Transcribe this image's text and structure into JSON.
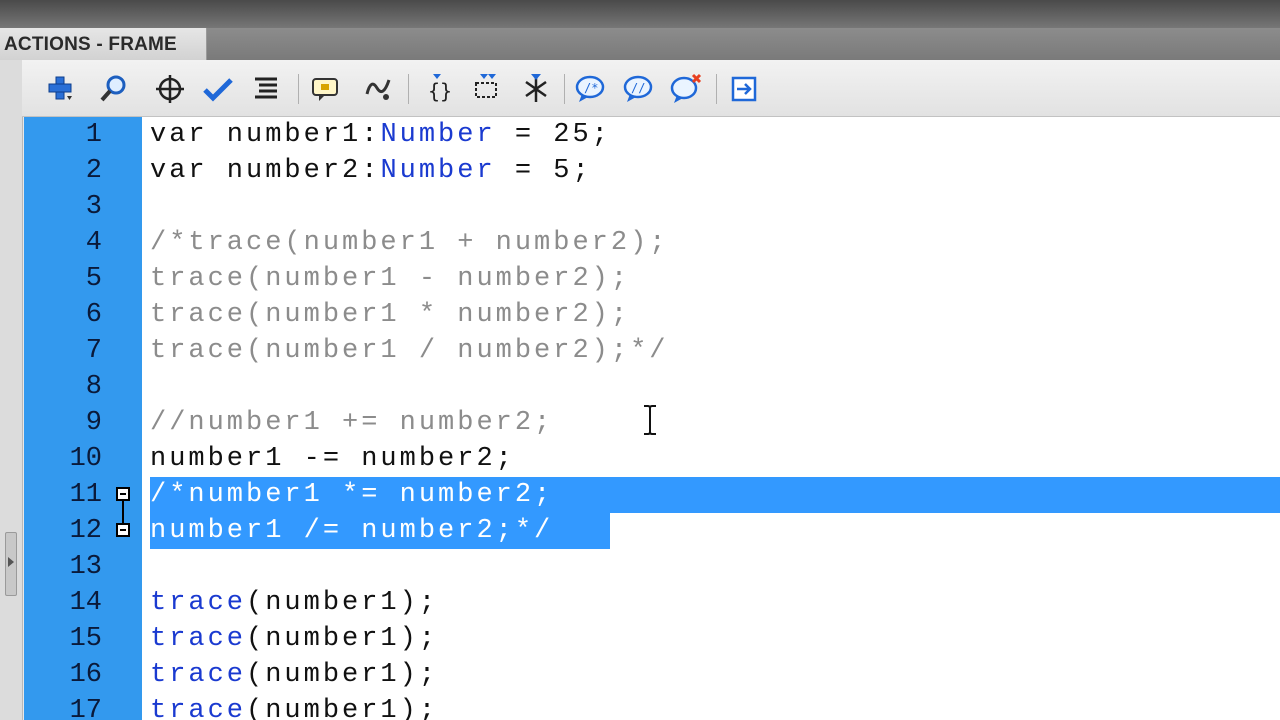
{
  "panel": {
    "title": "ACTIONS - FRAME"
  },
  "toolbar": {
    "buttons": [
      {
        "name": "add-statement-icon",
        "tooltip": ""
      },
      {
        "name": "find-icon",
        "tooltip": ""
      },
      {
        "name": "insert-target-path-icon",
        "tooltip": ""
      },
      {
        "name": "check-syntax-icon",
        "tooltip": ""
      },
      {
        "name": "auto-format-icon",
        "tooltip": ""
      },
      {
        "name": "show-code-hint-icon",
        "tooltip": ""
      },
      {
        "name": "debug-options-icon",
        "tooltip": ""
      },
      {
        "name": "collapse-between-braces-icon",
        "tooltip": ""
      },
      {
        "name": "collapse-selection-icon",
        "tooltip": ""
      },
      {
        "name": "expand-all-icon",
        "tooltip": ""
      },
      {
        "name": "apply-block-comment-icon",
        "tooltip": ""
      },
      {
        "name": "apply-line-comment-icon",
        "tooltip": ""
      },
      {
        "name": "remove-comment-icon",
        "tooltip": ""
      },
      {
        "name": "show-hide-toolbox-icon",
        "tooltip": ""
      }
    ]
  },
  "colors": {
    "gutter": "#3399ee",
    "selection": "#3399ff",
    "keyword": "#1a3ad0",
    "comment": "#8c8c8c"
  },
  "code_lines": [
    {
      "num": "1",
      "segments": [
        "var number1:",
        "Number",
        " = 25;"
      ]
    },
    {
      "num": "2",
      "segments": [
        "var number2:",
        "Number",
        " = 5;"
      ]
    },
    {
      "num": "3",
      "text": ""
    },
    {
      "num": "4",
      "text": "/*trace(number1 + number2);"
    },
    {
      "num": "5",
      "text": "trace(number1 - number2);"
    },
    {
      "num": "6",
      "text": "trace(number1 * number2);"
    },
    {
      "num": "7",
      "text": "trace(number1 / number2);*/"
    },
    {
      "num": "8",
      "text": ""
    },
    {
      "num": "9",
      "text": "//number1 += number2;"
    },
    {
      "num": "10",
      "text": "number1 -= number2;"
    },
    {
      "num": "11",
      "text": "/*number1 *= number2;"
    },
    {
      "num": "12",
      "text": "number1 /= number2;*/"
    },
    {
      "num": "13",
      "text": ""
    },
    {
      "num": "14",
      "segments": [
        "trace",
        "(number1);"
      ]
    },
    {
      "num": "15",
      "segments": [
        "trace",
        "(number1);"
      ]
    },
    {
      "num": "16",
      "segments": [
        "trace",
        "(number1);"
      ]
    },
    {
      "num": "17",
      "segments": [
        "trace",
        "(number1);"
      ]
    }
  ]
}
